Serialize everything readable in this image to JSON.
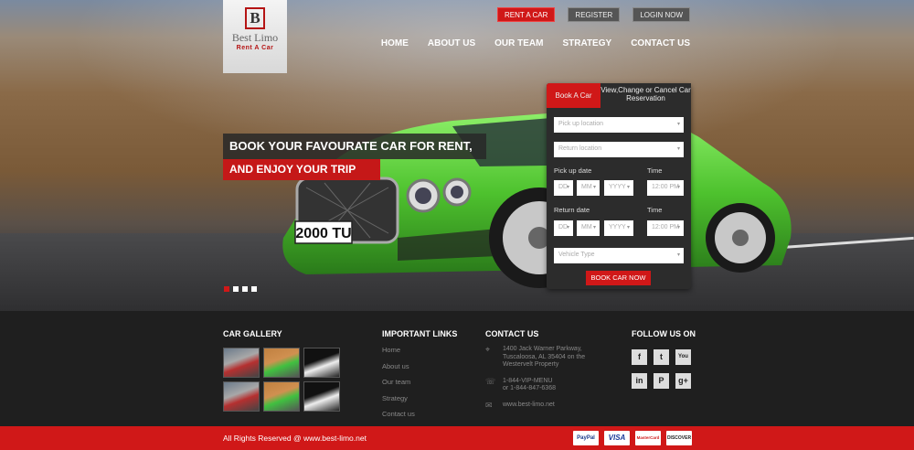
{
  "logo": {
    "mark": "B",
    "name": "Best Limo",
    "sub": "Rent A Car"
  },
  "top_buttons": [
    "RENT A CAR",
    "REGISTER",
    "LOGIN NOW"
  ],
  "nav": [
    "HOME",
    "ABOUT US",
    "OUR TEAM",
    "STRATEGY",
    "CONTACT US"
  ],
  "hero": {
    "line1": "BOOK YOUR FAVOURATE CAR FOR RENT,",
    "line2": "AND ENJOY YOUR TRIP",
    "plate": "2000 TU",
    "slides": 4,
    "active_slide": 0
  },
  "booking": {
    "tab_active": "Book A Car",
    "tab_other": "View,Change or Cancel Car Reservation",
    "pickup_location": "Pick up location",
    "return_location": "Return location",
    "pickup_date_label": "Pick up date",
    "return_date_label": "Return date",
    "time_label": "Time",
    "dd": "DD",
    "mm": "MM",
    "yyyy": "YYYY",
    "time_value": "12:00 PM",
    "vehicle_type": "Vehicle Type",
    "submit": "BOOK CAR NOW"
  },
  "footer": {
    "gallery_title": "CAR GALLERY",
    "links_title": "IMPORTANT LINKS",
    "links": [
      "Home",
      "About us",
      "Our team",
      "Strategy",
      "Contact us"
    ],
    "contact_title": "CONTACT US",
    "address": "1400 Jack Warner Parkway, Tuscaloosa, AL 35404 on the Westervelt Property",
    "phone1": "1-844-VIP-MENU",
    "phone2": "or 1-844-847-6368",
    "website": "www.best-limo.net",
    "follow_title": "FOLLOW US ON",
    "social": [
      {
        "glyph": "f"
      },
      {
        "glyph": "t"
      },
      {
        "glyph": "You"
      },
      {
        "glyph": "in"
      },
      {
        "glyph": "P"
      },
      {
        "glyph": "g+"
      }
    ]
  },
  "bottom": {
    "copyright": "All Rights Reserved @ www.best-limo.net",
    "cards": [
      "PayPal",
      "VISA",
      "MasterCard",
      "DISCOVER"
    ]
  },
  "colors": {
    "accent": "#d01818",
    "footer_bg": "#1f1f1f",
    "car_green": "#5ad23a"
  }
}
